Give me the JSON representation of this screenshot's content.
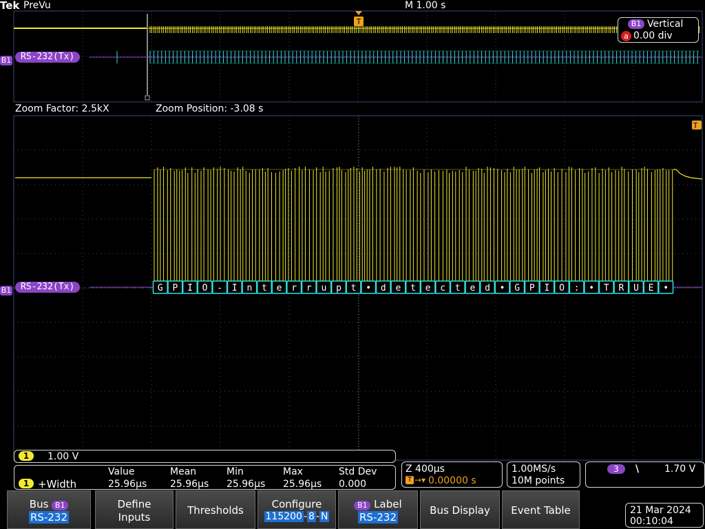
{
  "header": {
    "brand": "Tek",
    "mode": "PreVu",
    "timebase": "M 1.00 s"
  },
  "trigger_marker": "T",
  "bus_tag": "B1",
  "overview": {
    "bus_label": "RS-232(Tx)"
  },
  "vertical_box": {
    "bus": "B1",
    "title": "Vertical",
    "icon_letter": "a",
    "value": "0.00 div"
  },
  "zoom": {
    "factor_label": "Zoom Factor: 2.5kX",
    "position_label": "Zoom Position: -3.08 s"
  },
  "main": {
    "bus_label": "RS-232(Tx)",
    "decoded": [
      "G",
      "P",
      "I",
      "O",
      "-",
      "I",
      "n",
      "t",
      "e",
      "r",
      "r",
      "u",
      "p",
      "t",
      "•",
      "d",
      "e",
      "t",
      "e",
      "c",
      "t",
      "e",
      "d",
      "•",
      "G",
      "P",
      "I",
      "O",
      ":",
      "•",
      "T",
      "R",
      "U",
      "E",
      "•"
    ]
  },
  "channel1": {
    "number": "1",
    "scale": "1.00 V"
  },
  "measurement": {
    "channel": "1",
    "name": "+Width",
    "headers": [
      "Value",
      "Mean",
      "Min",
      "Max",
      "Std Dev"
    ],
    "values": [
      "25.96µs",
      "25.96µs",
      "25.96µs",
      "25.96µs",
      "0.000"
    ]
  },
  "zoom_box": {
    "z": "Z 400µs",
    "trigger_icon": "T",
    "delay": "0.00000 s"
  },
  "acq": {
    "rate": "1.00MS/s",
    "points": "10M points"
  },
  "trigger": {
    "channel": "3",
    "slope": "\\",
    "level": "1.70 V"
  },
  "buttons": {
    "bus": {
      "label": "Bus",
      "tag": "B1",
      "value": "RS-232"
    },
    "define_inputs": {
      "line1": "Define",
      "line2": "Inputs"
    },
    "thresholds": {
      "label": "Thresholds"
    },
    "configure": {
      "label": "Configure",
      "baud": "115200",
      "bits": "8",
      "parity": "N",
      "sep": "-"
    },
    "label": {
      "tag": "B1",
      "label": "Label",
      "value": "RS-232"
    },
    "bus_display": {
      "label": "Bus Display"
    },
    "event_table": {
      "label": "Event Table"
    }
  },
  "datetime": {
    "date": "21 Mar 2024",
    "time": "00:10:04"
  },
  "colors": {
    "ch1": "#f2ea2e",
    "bus": "#8a45c6",
    "decode": "#2fe0e0",
    "highlight": "#1e6fd0",
    "grid": "#3a4a78"
  }
}
